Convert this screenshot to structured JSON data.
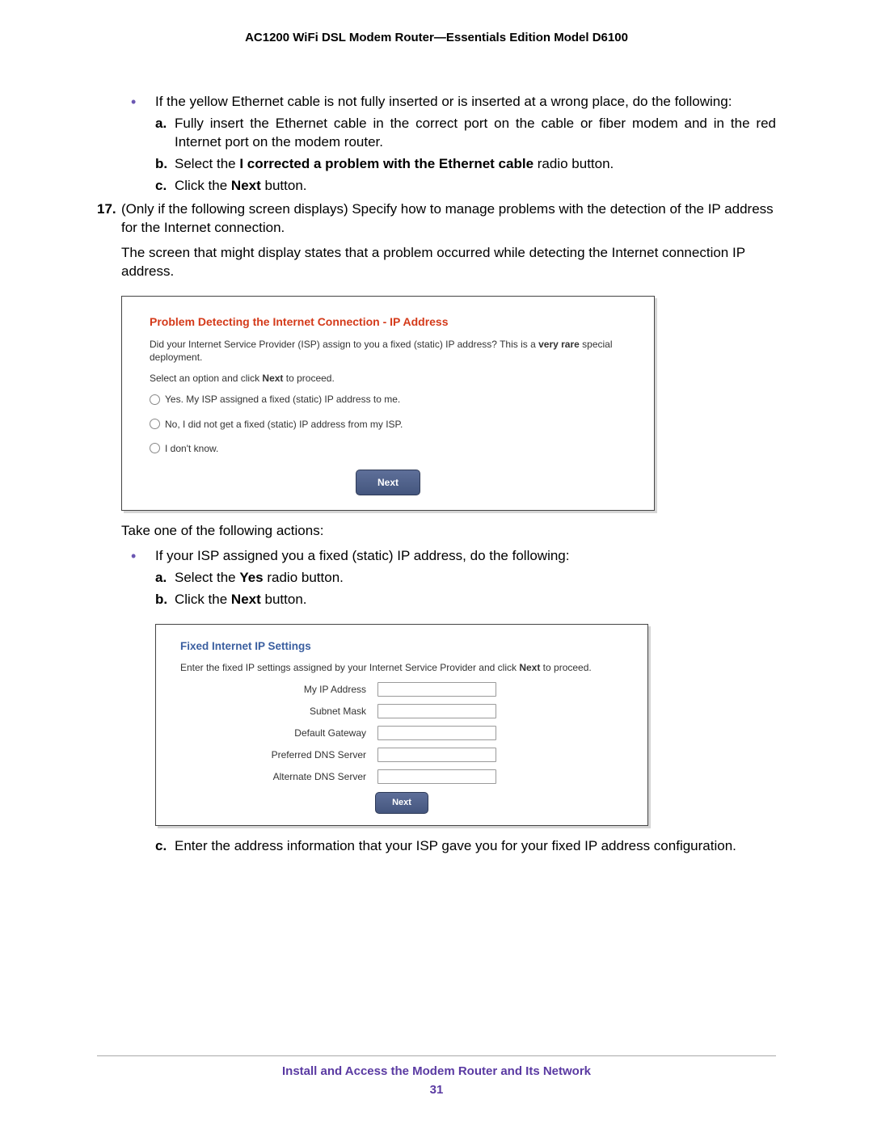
{
  "doc": {
    "header": "AC1200 WiFi DSL Modem Router—Essentials Edition Model D6100",
    "footer_title": "Install and Access the Modem Router and Its Network",
    "page_number": "31"
  },
  "body": {
    "bullet1": "If the yellow Ethernet cable is not fully inserted or is inserted at a wrong place, do the following:",
    "sub_a_label": "a.",
    "sub_a": "Fully insert the Ethernet cable in the correct port on the cable or fiber modem and in the red Internet port on the modem router.",
    "sub_b_label": "b.",
    "sub_b_pre": "Select the ",
    "sub_b_bold": "I corrected a problem with the Ethernet cable",
    "sub_b_post": " radio button.",
    "sub_c_label": "c.",
    "sub_c_pre": "Click the ",
    "sub_c_bold": "Next",
    "sub_c_post": " button.",
    "step17_label": "17.",
    "step17": "(Only if the following screen displays) Specify how to manage problems with the detection of the IP address for the Internet connection.",
    "step17_para": "The screen that might display states that a problem occurred while detecting the Internet connection IP address.",
    "take_action": "Take one of the following actions:",
    "bullet2": "If your ISP assigned you a fixed (static) IP address, do the following:",
    "b2_a_label": "a.",
    "b2_a_pre": "Select the ",
    "b2_a_bold": "Yes",
    "b2_a_post": " radio button.",
    "b2_b_label": "b.",
    "b2_b_pre": "Click the ",
    "b2_b_bold": "Next",
    "b2_b_post": " button.",
    "b2_c_label": "c.",
    "b2_c": "Enter the address information that your ISP gave you for your fixed IP address configuration."
  },
  "shot1": {
    "title": "Problem Detecting the Internet Connection - IP Address",
    "line1_pre": "Did your Internet Service Provider (ISP) assign to you a fixed (static) IP address? This is a ",
    "line1_bold": "very rare",
    "line1_post": " special deployment.",
    "line2_pre": "Select an option and click ",
    "line2_bold": "Next",
    "line2_post": " to proceed.",
    "opt1": "Yes. My ISP assigned a fixed (static) IP address to me.",
    "opt2": "No, I did not get a fixed (static) IP address from my ISP.",
    "opt3": "I don't know.",
    "next": "Next"
  },
  "shot2": {
    "title": "Fixed Internet IP Settings",
    "intro_pre": "Enter the fixed IP settings assigned by your Internet Service Provider and click ",
    "intro_bold": "Next",
    "intro_post": " to proceed.",
    "f1": "My IP Address",
    "f2": "Subnet Mask",
    "f3": "Default Gateway",
    "f4": "Preferred DNS Server",
    "f5": "Alternate DNS Server",
    "next": "Next"
  }
}
